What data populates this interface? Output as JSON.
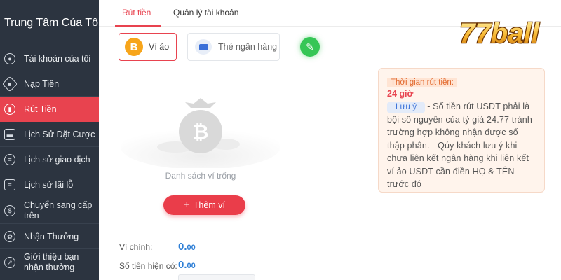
{
  "sidebar": {
    "title": "Trung Tâm Của Tôi",
    "items": [
      {
        "label": "Tài khoản của tôi",
        "icon": "user-icon"
      },
      {
        "label": "Nạp Tiền",
        "icon": "deposit-icon"
      },
      {
        "label": "Rút Tiền",
        "icon": "withdraw-icon"
      },
      {
        "label": "Lịch Sử Đặt Cược",
        "icon": "wallet-icon"
      },
      {
        "label": "Lịch sử giao dịch",
        "icon": "receipt-icon"
      },
      {
        "label": "Lịch sử lãi lỗ",
        "icon": "report-icon"
      },
      {
        "label": "Chuyển sang cấp trên",
        "icon": "transfer-icon"
      },
      {
        "label": "Nhận Thưởng",
        "icon": "gift-icon"
      },
      {
        "label": "Giới thiệu bạn nhận thưởng",
        "icon": "share-icon"
      }
    ]
  },
  "tabs": [
    {
      "label": "Rút tiền"
    },
    {
      "label": "Quản lý tài khoản"
    }
  ],
  "options": {
    "vi_ao": "Ví ảo",
    "bank": "Thẻ ngân hàng"
  },
  "empty": {
    "label": "Danh sách ví trống"
  },
  "add_button": "Thêm ví",
  "info": {
    "heading": "Thời gian rút tiền:",
    "time": "24 giờ",
    "note_badge": "Lưu ý",
    "note_text": "- Số tiền rút USDT phải là bội số nguyên của tỷ giá 24.77 tránh trường hợp không nhận được số thập phân. - Qúy khách lưu ý khi chưa liên kết ngân hàng khi liên kết ví ảo USDT cần điền HỌ & TÊN trước đó"
  },
  "balances": {
    "main_label": "Ví chính:",
    "main_int": "0.",
    "main_dec": "00",
    "available_label": "Số tiền hiện có:",
    "available_int": "0.",
    "available_dec": "00"
  },
  "logo": {
    "text": "77ball"
  },
  "colors": {
    "sidebar_bg": "#2c3440",
    "accent_red": "#e8434f",
    "coin_orange": "#f7a51b",
    "success_green": "#36c656",
    "balance_blue": "#2e7fd6"
  }
}
